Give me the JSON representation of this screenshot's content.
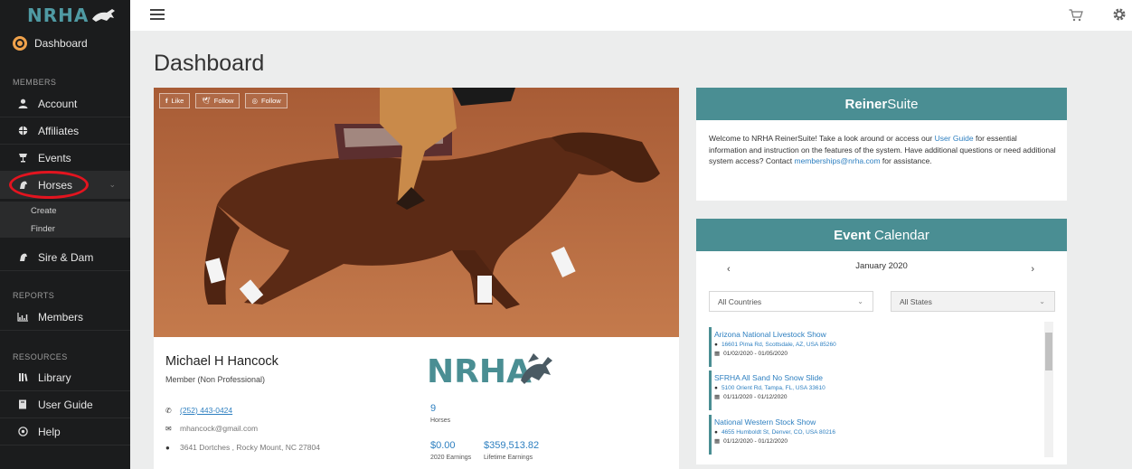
{
  "app": {
    "logo_text": "NRHA"
  },
  "sidebar": {
    "dashboard": "Dashboard",
    "sections": {
      "members": "MEMBERS",
      "reports": "REPORTS",
      "resources": "RESOURCES"
    },
    "items": {
      "account": "Account",
      "affiliates": "Affiliates",
      "events": "Events",
      "horses": "Horses",
      "create": "Create",
      "finder": "Finder",
      "sire_dam": "Sire & Dam",
      "members": "Members",
      "library": "Library",
      "user_guide": "User Guide",
      "help": "Help"
    }
  },
  "main": {
    "title": "Dashboard",
    "social": {
      "like": "Like",
      "follow": "Follow",
      "follow2": "Follow"
    }
  },
  "profile": {
    "name": "Michael H Hancock",
    "type": "Member (Non Professional)",
    "phone": "(252) 443-0424",
    "email": "mhancock@gmail.com",
    "address": "3641 Dortches , Rocky Mount, NC 27804",
    "logo_text": "NRHA",
    "horses_count": "9",
    "horses_label": "Horses",
    "earnings_2020": "$0.00",
    "earnings_2020_label": "2020 Earnings",
    "lifetime_earnings": "$359,513.82",
    "lifetime_label": "Lifetime Earnings"
  },
  "reiner_panel": {
    "title_bold": "Reiner",
    "title_light": "Suite",
    "text_1": "Welcome to NRHA ReinerSuite! Take a look around or access our ",
    "link_user_guide": "User Guide",
    "text_2": " for essential information and instruction on the features of the system. Have additional questions or need additional system access? Contact ",
    "link_email": "memberships@nrha.com",
    "text_3": " for assistance."
  },
  "calendar": {
    "title_bold": "Event",
    "title_light": " Calendar",
    "month": "January 2020",
    "prev": "‹",
    "next": "›",
    "country_select": "All Countries",
    "state_select": "All States",
    "events": [
      {
        "title": "Arizona National Livestock Show",
        "address": "16601 Pima Rd, Scottsdale, AZ, USA 85260",
        "dates": "01/02/2020 - 01/05/2020"
      },
      {
        "title": "SFRHA All Sand No Snow Slide",
        "address": "5100 Orient Rd, Tampa, FL, USA 33610",
        "dates": "01/11/2020 - 01/12/2020"
      },
      {
        "title": "National Western Stock Show",
        "address": "4655 Humboldt St, Denver, CO, USA 80216",
        "dates": "01/12/2020 - 01/12/2020"
      }
    ]
  },
  "colors": {
    "accent": "#4a8e93",
    "link": "#2d7fc0",
    "sidebar_bg": "#1b1c1d",
    "highlight_circle": "#e3141f",
    "dashboard_icon": "#f0a24b"
  },
  "icons": [
    "menu-icon",
    "cart-icon",
    "gear-icon",
    "dashboard-icon",
    "user-icon",
    "globe-icon",
    "trophy-icon",
    "horse-icon",
    "chevron-down-icon",
    "chart-icon",
    "library-icon",
    "book-icon",
    "help-icon",
    "phone-icon",
    "email-icon",
    "location-icon",
    "calendar-icon"
  ]
}
